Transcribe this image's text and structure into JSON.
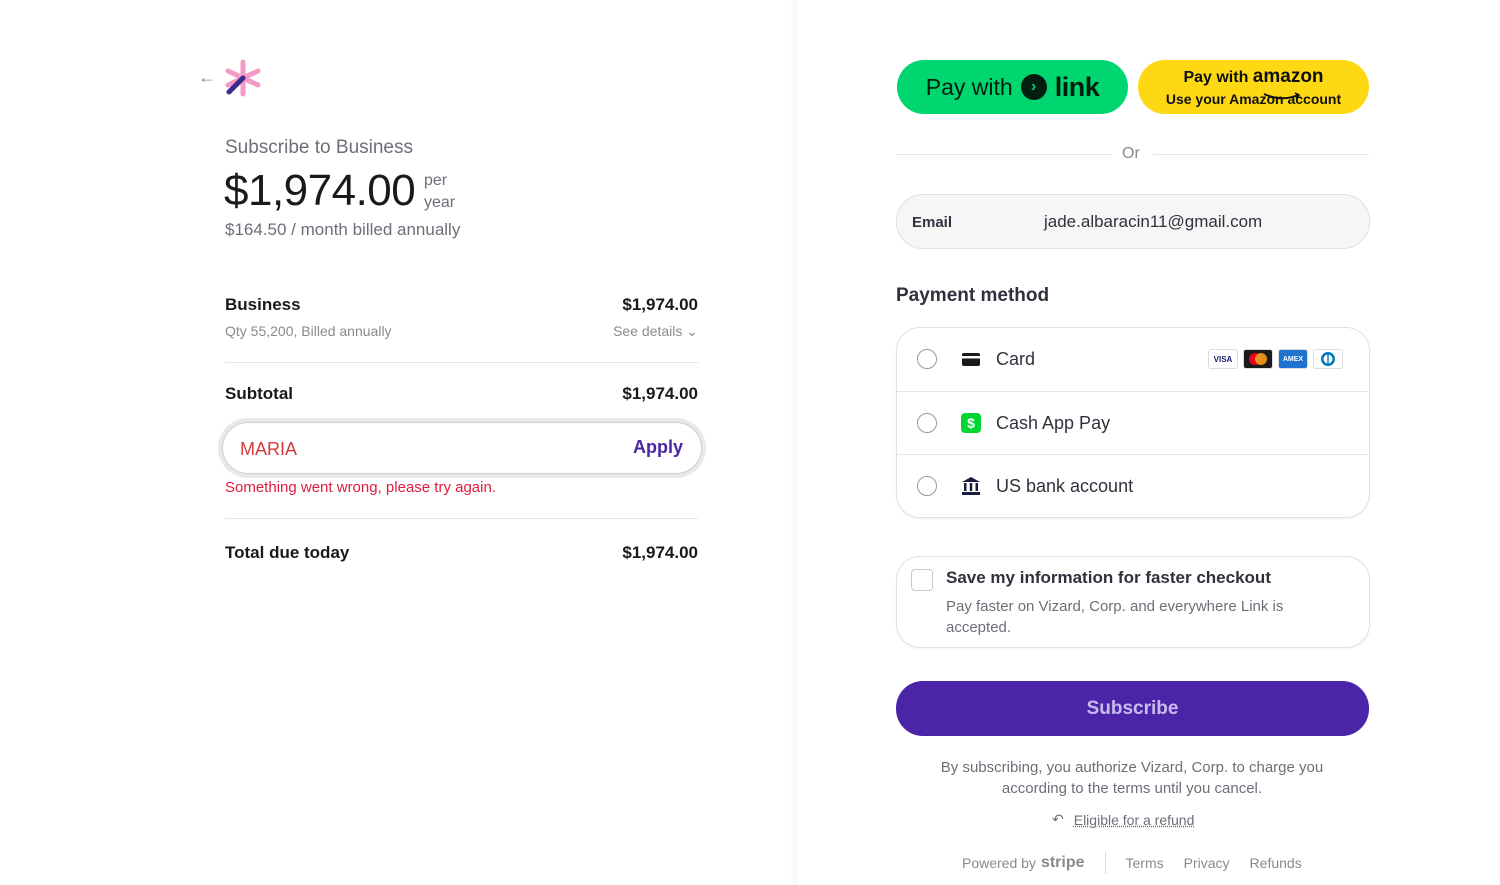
{
  "product": {
    "subscribe_title": "Subscribe to Business",
    "price": "$1,974.00",
    "per_line1": "per",
    "per_line2": "year",
    "monthly_note": "$164.50 / month billed annually"
  },
  "line_item": {
    "name": "Business",
    "price": "$1,974.00",
    "meta": "Qty 55,200, Billed annually",
    "see_details": "See details"
  },
  "subtotal": {
    "label": "Subtotal",
    "value": "$1,974.00"
  },
  "promo": {
    "value": "MARIA",
    "apply_label": "Apply",
    "error": "Something went wrong, please try again."
  },
  "total": {
    "label": "Total due today",
    "value": "$1,974.00"
  },
  "express": {
    "link_prefix": "Pay with",
    "link_brand": "link",
    "amazon_prefix": "Pay with",
    "amazon_brand": "amazon",
    "amazon_sub": "Use your Amazon account"
  },
  "or_label": "Or",
  "email": {
    "label": "Email",
    "value": "jade.albaracin11@gmail.com"
  },
  "payment": {
    "title": "Payment method",
    "options": [
      {
        "label": "Card",
        "icon": "card-icon"
      },
      {
        "label": "Cash App Pay",
        "icon": "cash-app-icon"
      },
      {
        "label": "US bank account",
        "icon": "bank-icon"
      }
    ],
    "brands": [
      "VISA",
      "mastercard",
      "AMEX",
      "diners"
    ]
  },
  "save_info": {
    "title": "Save my information for faster checkout",
    "desc": "Pay faster on Vizard, Corp. and everywhere Link is accepted."
  },
  "subscribe_label": "Subscribe",
  "legal": "By subscribing, you authorize Vizard, Corp. to charge you according to the terms until you cancel.",
  "refund_label": "Eligible for a refund",
  "footer": {
    "powered_by": "Powered by",
    "stripe": "stripe",
    "links": [
      "Terms",
      "Privacy",
      "Refunds"
    ]
  },
  "colors": {
    "link_green": "#00d66f",
    "amazon_yellow": "#ffd814",
    "subscribe_purple": "#4b24a8",
    "error_red": "#df1b41"
  }
}
